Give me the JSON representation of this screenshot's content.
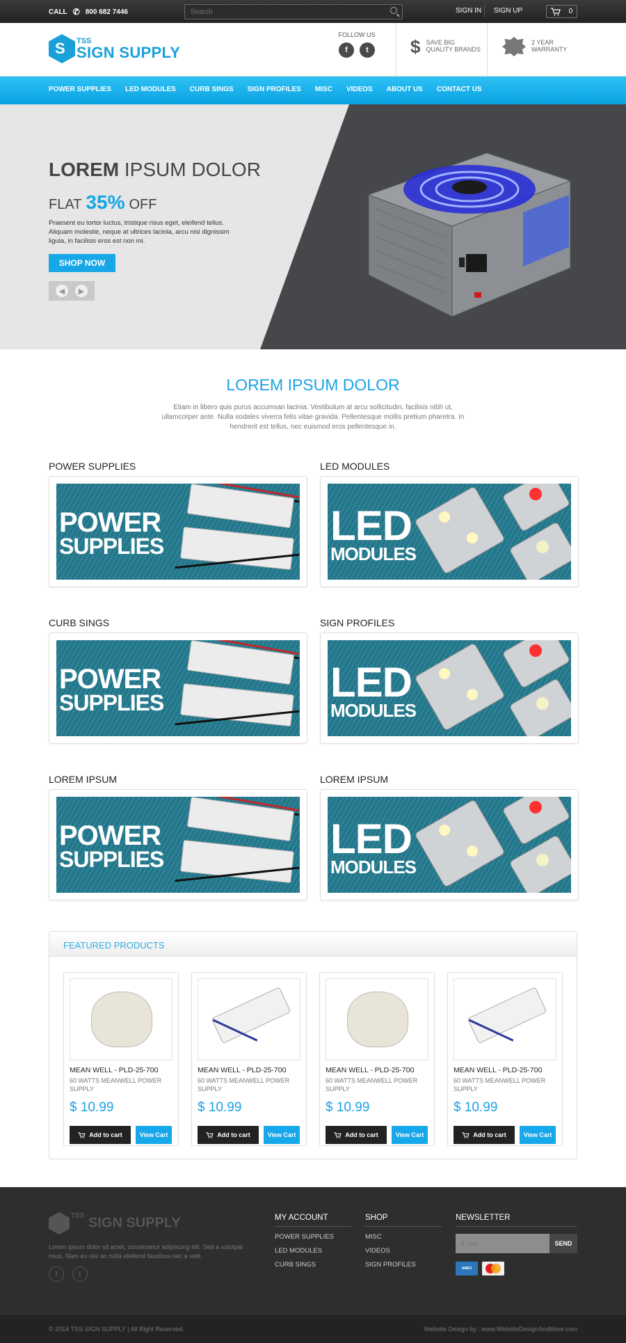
{
  "topbar": {
    "call_label": "CALL",
    "phone": "800 682 7446",
    "search_placeholder": "Search",
    "signin": "SIGN IN",
    "signup": "SIGN UP",
    "cart_count": "0"
  },
  "header": {
    "logo_small": "TSS",
    "logo_name": "SIGN SUPPLY",
    "follow_label": "FOLLOW US",
    "usp1_line1": "SAVE BIG",
    "usp1_line2": "QUALITY BRANDS",
    "usp2_line1": "2 YEAR",
    "usp2_line2": "WARRANTY"
  },
  "nav": [
    "POWER SUPPLIES",
    "LED MODULES",
    "CURB SINGS",
    "SIGN PROFILES",
    "MISC",
    "VIDEOS",
    "ABOUT US",
    "CONTACT US"
  ],
  "hero": {
    "title_bold": "LOREM",
    "title_rest": "IPSUM DOLOR",
    "flat": "FLAT",
    "percent": "35%",
    "off": "OFF",
    "text": "Praesent eu tortor luctus, tristique risus eget, eleifend tellus. Aliquam molestie, neque at ultrices lacinia, arcu nisi dignissim ligula, in facilisis eros est non mi.",
    "cta": "SHOP NOW"
  },
  "intro": {
    "title": "LOREM IPSUM DOLOR",
    "text": "Etiam in libero quis purus accumsan lacinia. Vestibulum at arcu sollicitudin, facilisis nibh ut, ullamcorper ante. Nulla sodales viverra felis vitae gravida. Pellentesque mollis pretium pharetra. In hendrerit est tellus, nec euismod eros pellentesque in."
  },
  "categories": [
    {
      "title": "POWER SUPPLIES",
      "banner_l1": "POWER",
      "banner_l2": "SUPPLIES",
      "kind": "power"
    },
    {
      "title": "LED MODULES",
      "banner_l1": "LED",
      "banner_l2": "MODULES",
      "kind": "led"
    },
    {
      "title": "CURB SINGS",
      "banner_l1": "POWER",
      "banner_l2": "SUPPLIES",
      "kind": "power"
    },
    {
      "title": "SIGN PROFILES",
      "banner_l1": "LED",
      "banner_l2": "MODULES",
      "kind": "led"
    },
    {
      "title": "LOREM IPSUM",
      "banner_l1": "POWER",
      "banner_l2": "SUPPLIES",
      "kind": "power"
    },
    {
      "title": "LOREM IPSUM",
      "banner_l1": "LED",
      "banner_l2": "MODULES",
      "kind": "led"
    }
  ],
  "featured": {
    "title": "FEATURED PRODUCTS",
    "products": [
      {
        "name": "MEAN WELL - PLD-25-700",
        "desc": "60 WATTS MEANWELL POWER SUPPLY",
        "price": "$ 10.99",
        "add": "Add to cart",
        "view": "View Cart",
        "img": "round"
      },
      {
        "name": "MEAN WELL - PLD-25-700",
        "desc": "60 WATTS MEANWELL POWER SUPPLY",
        "price": "$ 10.99",
        "add": "Add to cart",
        "view": "View Cart",
        "img": "bar"
      },
      {
        "name": "MEAN WELL - PLD-25-700",
        "desc": "60 WATTS MEANWELL POWER SUPPLY",
        "price": "$ 10.99",
        "add": "Add to cart",
        "view": "View Cart",
        "img": "round"
      },
      {
        "name": "MEAN WELL - PLD-25-700",
        "desc": "60 WATTS MEANWELL POWER SUPPLY",
        "price": "$ 10.99",
        "add": "Add to cart",
        "view": "View Cart",
        "img": "bar"
      }
    ]
  },
  "footer": {
    "logo_small": "TSS",
    "logo_name": "SIGN SUPPLY",
    "text": "Lorem ipsum dolor sit amet, consectetur adipiscing elit. Sed a volutpat risus. Nam eu nisi ac nulla eleifend faucibus nec a velit.",
    "my_account": {
      "title": "MY ACCOUNT",
      "items": [
        "POWER SUPPLIES",
        "LED MODULES",
        "CURB SINGS"
      ]
    },
    "shop": {
      "title": "SHOP",
      "items": [
        "MISC",
        "VIDEOS",
        "SIGN PROFILES"
      ]
    },
    "newsletter": {
      "title": "NEWSLETTER",
      "placeholder": "E mail",
      "send": "SEND"
    },
    "copyright": "© 2014 TSS SIGN SUPPLY | All Right Reserved.",
    "credit": "Website Design by : www.WebsiteDesignAndMore.com"
  },
  "colors": {
    "accent": "#19a3e5",
    "dark": "#2e2e2e",
    "banner": "#2d8296"
  }
}
